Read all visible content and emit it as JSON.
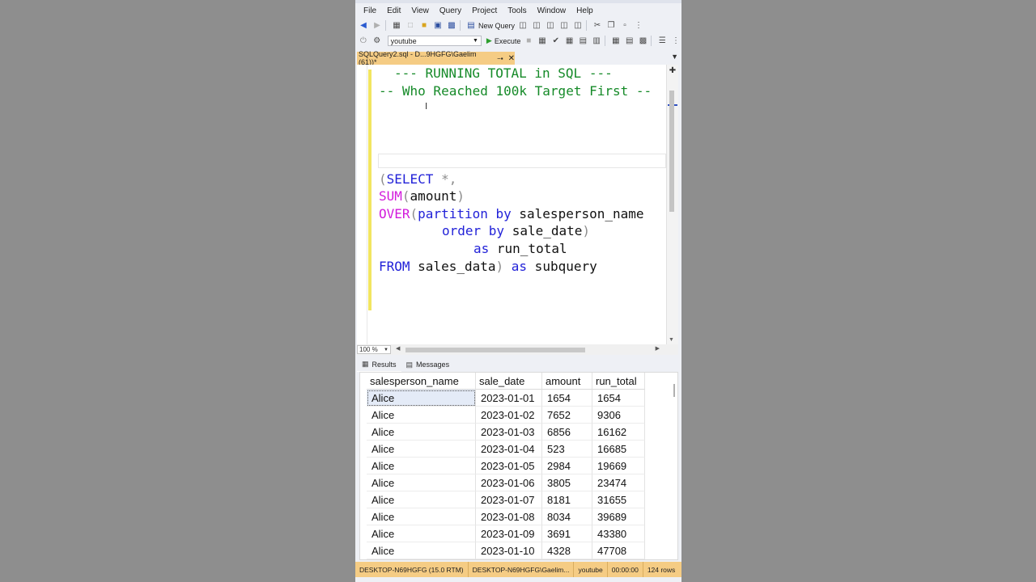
{
  "menu": [
    "File",
    "Edit",
    "View",
    "Query",
    "Project",
    "Tools",
    "Window",
    "Help"
  ],
  "toolbar": {
    "new_query": "New Query",
    "database": "youtube",
    "execute": "Execute"
  },
  "tab": {
    "title": "SQLQuery2.sql - D...9HGFG\\Gaelim (61))*"
  },
  "code": {
    "line1": "--- RUNNING TOTAL in SQL ---",
    "line2": "-- Who Reached 100k Target First --",
    "l3_paren": "(",
    "l3_select": "SELECT",
    "l3_rest": " *,",
    "l4_sum": "SUM",
    "l4_open": "(",
    "l4_arg": "amount",
    "l4_close": ")",
    "l5_over": "OVER",
    "l5_open": "(",
    "l5_partition": "partition by",
    "l5_col": " salesperson_name",
    "l6_order": "order by",
    "l6_col": " sale_date",
    "l6_close": ")",
    "l7_as": "as",
    "l7_alias": " run_total",
    "l8_from": "FROM",
    "l8_table": " sales_data",
    "l8_close": ")",
    "l8_as": "as",
    "l8_alias": " subquery"
  },
  "zoom": "100 %",
  "result_tabs": {
    "results": "Results",
    "messages": "Messages"
  },
  "results": {
    "columns": [
      "salesperson_name",
      "sale_date",
      "amount",
      "run_total"
    ],
    "rows": [
      [
        "Alice",
        "2023-01-01",
        "1654",
        "1654"
      ],
      [
        "Alice",
        "2023-01-02",
        "7652",
        "9306"
      ],
      [
        "Alice",
        "2023-01-03",
        "6856",
        "16162"
      ],
      [
        "Alice",
        "2023-01-04",
        "523",
        "16685"
      ],
      [
        "Alice",
        "2023-01-05",
        "2984",
        "19669"
      ],
      [
        "Alice",
        "2023-01-06",
        "3805",
        "23474"
      ],
      [
        "Alice",
        "2023-01-07",
        "8181",
        "31655"
      ],
      [
        "Alice",
        "2023-01-08",
        "8034",
        "39689"
      ],
      [
        "Alice",
        "2023-01-09",
        "3691",
        "43380"
      ],
      [
        "Alice",
        "2023-01-10",
        "4328",
        "47708"
      ]
    ]
  },
  "status": {
    "server": "DESKTOP-N69HGFG (15.0 RTM)",
    "user": "DESKTOP-N69HGFG\\Gaelim...",
    "database": "youtube",
    "time": "00:00:00",
    "rows": "124 rows"
  }
}
